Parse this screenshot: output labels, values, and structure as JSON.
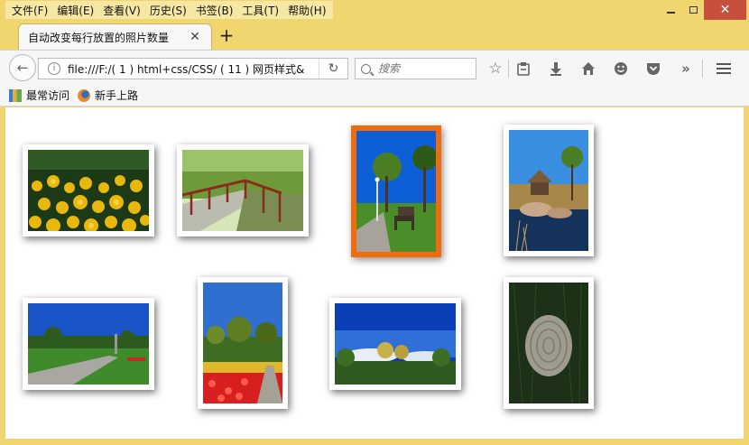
{
  "menu": [
    "文件(F)",
    "编辑(E)",
    "查看(V)",
    "历史(S)",
    "书签(B)",
    "工具(T)",
    "帮助(H)"
  ],
  "tab": {
    "title": "自动改变每行放置的照片数量",
    "close": "✕"
  },
  "new_tab": "+",
  "address": {
    "url": "file:///F:/( 1 ) html+css/CSS/ ( 11 ) 网页样式&",
    "info": "i"
  },
  "search": {
    "placeholder": "搜索"
  },
  "bookmarks": [
    "最常访问",
    "新手上路"
  ],
  "window": {
    "close": "✕"
  }
}
